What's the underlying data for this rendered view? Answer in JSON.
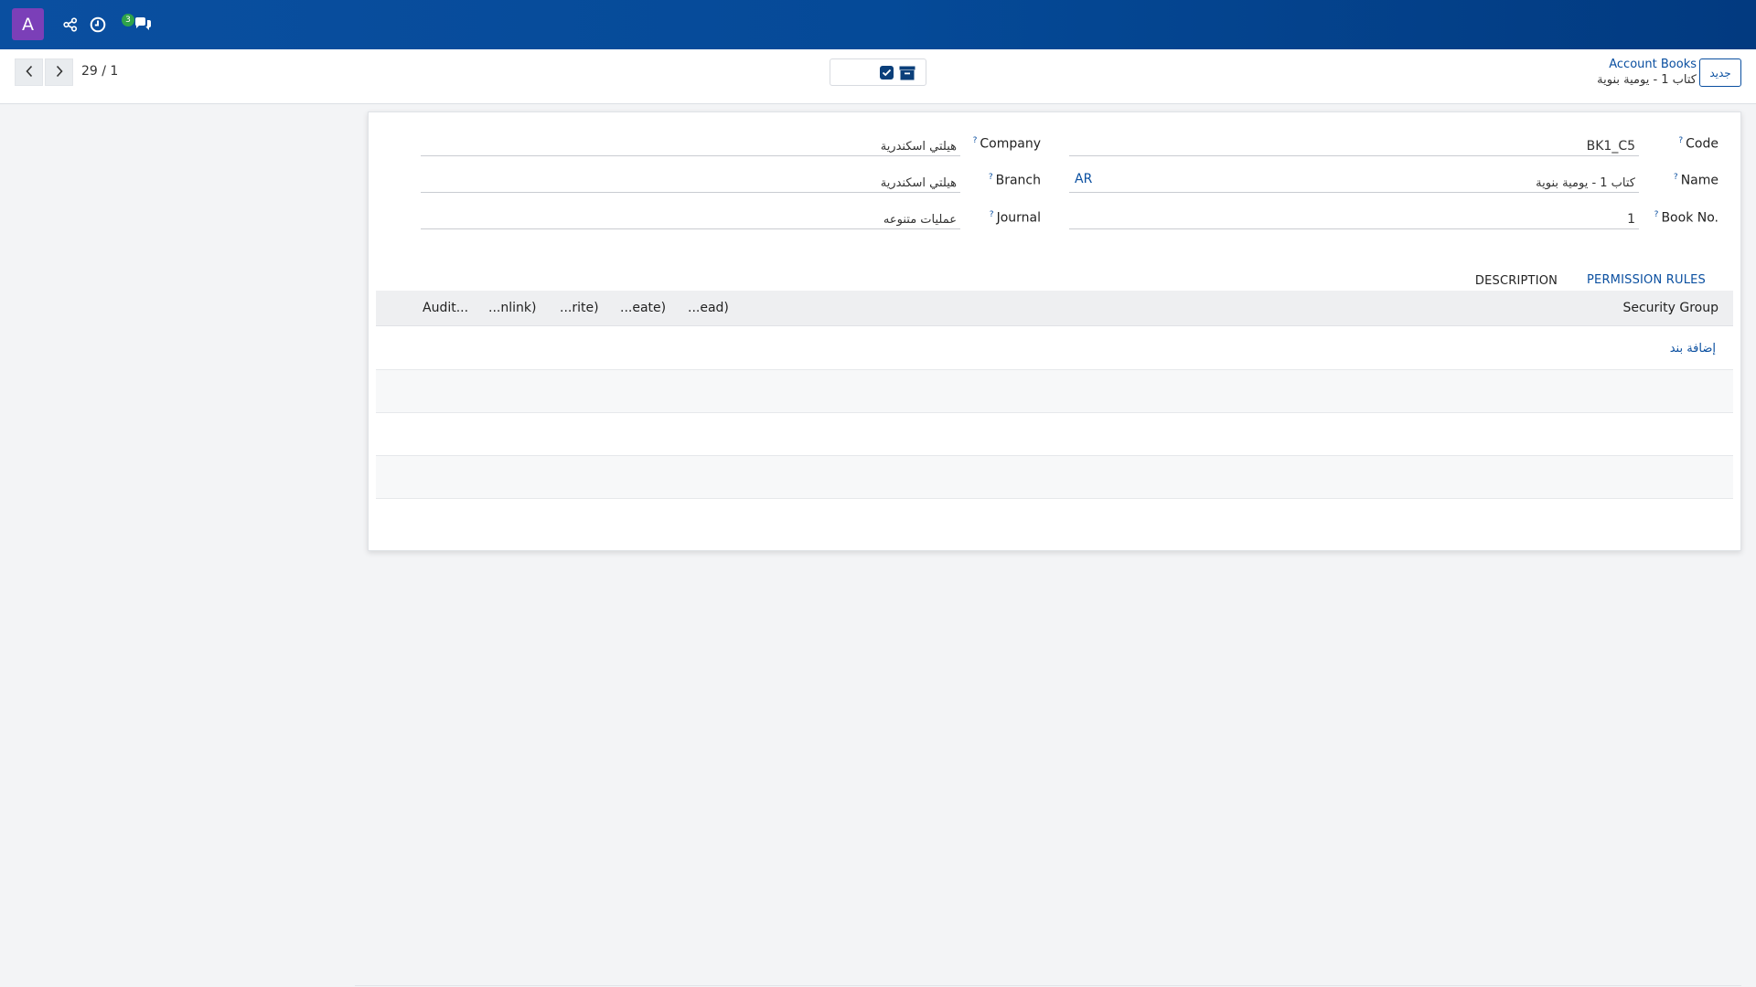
{
  "navbar": {
    "avatar_letter": "A",
    "icons": [
      "share-nodes-icon",
      "clock-icon",
      "chat-icon"
    ],
    "chat_badge": "3"
  },
  "pager": {
    "text": "29 / 1"
  },
  "breadcrumb": {
    "parent": "Account Books",
    "current": "كتاب 1 - يومية بنوية"
  },
  "new_button_label": "جديد",
  "form": {
    "code_label": "Code",
    "code_value": "BK1_C5",
    "name_label": "Name",
    "name_value": "كتاب 1 - يومية بنوية",
    "name_lang": "AR",
    "book_no_label": "Book No.",
    "book_no_value": "1",
    "company_label": "Company",
    "company_value": "هيلتي اسكندرية",
    "branch_label": "Branch",
    "branch_value": "هيلتي اسكندرية",
    "journal_label": "Journal",
    "journal_value": "عمليات متنوعه",
    "help_mark": "?"
  },
  "tabs": {
    "permission_rules": "PERMISSION RULES",
    "description": "DESCRIPTION"
  },
  "table": {
    "columns": [
      "Security Group",
      "...ead)",
      "...eate)",
      "...rite)",
      "...nlink)",
      "Audit..."
    ],
    "add_line": "إضافة بند"
  },
  "colors": {
    "navbar": "#054a98",
    "accent": "#0a4fa0",
    "avatar": "#7b3fb8",
    "badge": "#2fa34a"
  }
}
